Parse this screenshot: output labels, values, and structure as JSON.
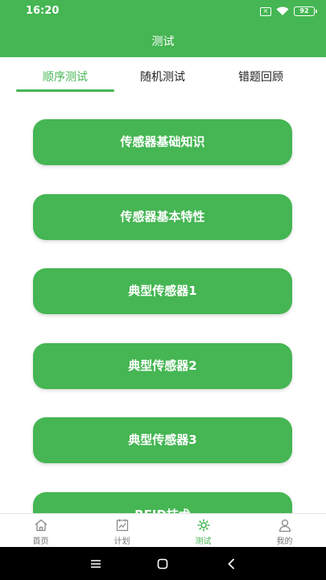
{
  "status_bar": {
    "time": "16:20",
    "sim_label": "×",
    "battery": "92"
  },
  "header": {
    "title": "测试"
  },
  "tabs": [
    {
      "label": "顺序测试",
      "active": true
    },
    {
      "label": "随机测试",
      "active": false
    },
    {
      "label": "错题回顾",
      "active": false
    }
  ],
  "quiz_items": [
    {
      "label": "传感器基础知识"
    },
    {
      "label": "传感器基本特性"
    },
    {
      "label": "典型传感器1"
    },
    {
      "label": "典型传感器2"
    },
    {
      "label": "典型传感器3"
    },
    {
      "label": "RFID技术"
    }
  ],
  "bottom_nav": [
    {
      "label": "首页",
      "icon": "home-icon",
      "active": false
    },
    {
      "label": "计划",
      "icon": "plan-icon",
      "active": false
    },
    {
      "label": "测试",
      "icon": "test-icon",
      "active": true
    },
    {
      "label": "我的",
      "icon": "profile-icon",
      "active": false
    }
  ],
  "colors": {
    "accent": "#45b653",
    "inactive": "#777777"
  }
}
